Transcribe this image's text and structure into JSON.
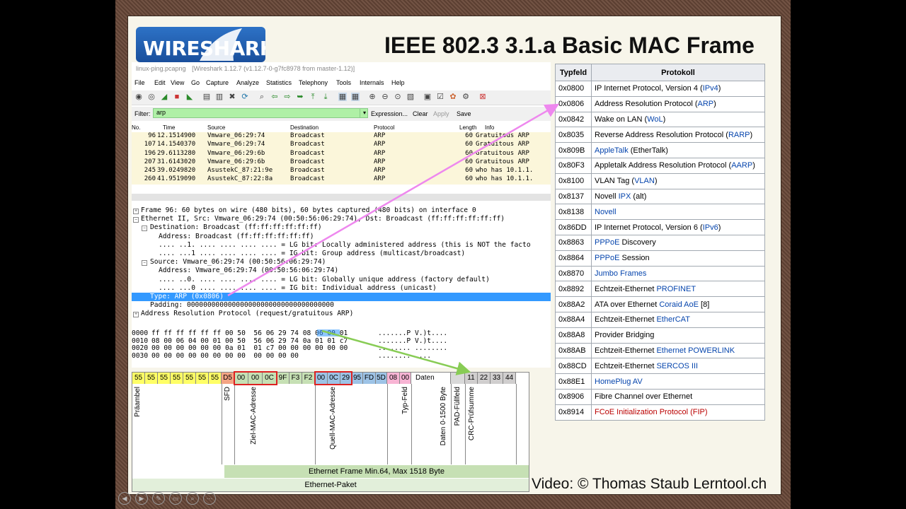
{
  "slide": {
    "logo_text": "WIRESHARK",
    "title": "IEEE 802.3 3.1.a Basic MAC Frame",
    "credit": "Video: © Thomas Staub Lerntool.ch"
  },
  "wireshark": {
    "window_file": "linux-ping.pcapng",
    "window_app": "[Wireshark 1.12.7 (v1.12.7-0-g7fc8978 from master-1.12)]",
    "menu": [
      "File",
      "Edit",
      "View",
      "Go",
      "Capture",
      "Analyze",
      "Statistics",
      "Telephony",
      "Tools",
      "Internals",
      "Help"
    ],
    "filter": {
      "label": "Filter:",
      "value": "arp",
      "expression": "Expression...",
      "clear": "Clear",
      "apply": "Apply",
      "save": "Save"
    },
    "columns": [
      "No.",
      "Time",
      "Source",
      "Destination",
      "Protocol",
      "Length",
      "Info"
    ],
    "packets": [
      {
        "no": "96",
        "time": "12.1514900",
        "src": "Vmware_06:29:74",
        "dst": "Broadcast",
        "proto": "ARP",
        "len": "60",
        "info": "Gratuitous ARP"
      },
      {
        "no": "107",
        "time": "14.1540370",
        "src": "Vmware_06:29:74",
        "dst": "Broadcast",
        "proto": "ARP",
        "len": "60",
        "info": "Gratuitous ARP"
      },
      {
        "no": "196",
        "time": "29.6113280",
        "src": "Vmware_06:29:6b",
        "dst": "Broadcast",
        "proto": "ARP",
        "len": "60",
        "info": "Gratuitous ARP"
      },
      {
        "no": "207",
        "time": "31.6143020",
        "src": "Vmware_06:29:6b",
        "dst": "Broadcast",
        "proto": "ARP",
        "len": "60",
        "info": "Gratuitous ARP"
      },
      {
        "no": "245",
        "time": "39.0249820",
        "src": "AsustekC_87:21:9e",
        "dst": "Broadcast",
        "proto": "ARP",
        "len": "60",
        "info": "who has 10.1.1."
      },
      {
        "no": "260",
        "time": "41.9519090",
        "src": "AsustekC_87:22:8a",
        "dst": "Broadcast",
        "proto": "ARP",
        "len": "60",
        "info": "who has 10.1.1."
      }
    ],
    "details": [
      "Frame 96: 60 bytes on wire (480 bits), 60 bytes captured (480 bits) on interface 0",
      "Ethernet II, Src: Vmware_06:29:74 (00:50:56:06:29:74), Dst: Broadcast (ff:ff:ff:ff:ff:ff)",
      "Destination: Broadcast (ff:ff:ff:ff:ff:ff)",
      "Address: Broadcast (ff:ff:ff:ff:ff:ff)",
      ".... ..1. .... .... .... .... = LG bit: Locally administered address (this is NOT the facto",
      ".... ...1 .... .... .... .... = IG bit: Group address (multicast/broadcast)",
      "Source: Vmware_06:29:74 (00:50:56:06:29:74)",
      "Address: Vmware_06:29:74 (00:50:56:06:29:74)",
      ".... ..0. .... .... .... .... = LG bit: Globally unique address (factory default)",
      ".... ...0 .... .... .... .... = IG bit: Individual address (unicast)",
      "Type: ARP (0x0806)",
      "Padding: 000000000000000000000000000000000000",
      "Address Resolution Protocol (request/gratuitous ARP)"
    ],
    "hex": [
      {
        "off": "0000",
        "bytes": "ff ff ff ff ff ff 00 50  56 06 29 74 08 06 00 01",
        "ascii": ".......P V.)t...."
      },
      {
        "off": "0010",
        "bytes": "08 00 06 04 00 01 00 50  56 06 29 74 0a 01 01 c7",
        "ascii": ".......P V.)t...."
      },
      {
        "off": "0020",
        "bytes": "00 00 00 00 00 00 0a 01  01 c7 00 00 00 00 00 00",
        "ascii": "........ ........"
      },
      {
        "off": "0030",
        "bytes": "00 00 00 00 00 00 00 00  00 00 00 00",
        "ascii": "........ ...."
      }
    ]
  },
  "frame_diagram": {
    "cells": [
      "55",
      "55",
      "55",
      "55",
      "55",
      "55",
      "55",
      "D5",
      "00",
      "00",
      "0C",
      "9F",
      "F3",
      "F2",
      "00",
      "0C",
      "29",
      "95",
      "FD",
      "5D",
      "08",
      "00",
      "Daten",
      "",
      "11",
      "22",
      "33",
      "44"
    ],
    "labels": {
      "preamble": "Präambel",
      "sfd": "SFD",
      "dest": "Ziel-MAC-Adresse",
      "src": "Quell-MAC-Adresse",
      "type": "Typ-Feld",
      "data": "Daten 0-1500 Byte",
      "pad": "PAD-Füllfeld",
      "crc": "CRC-Prüfsumme"
    },
    "frame_band": "Ethernet Frame Min.64, Max 1518 Byte",
    "packet_band": "Ethernet-Paket"
  },
  "typfeld_table": {
    "headers": [
      "Typfeld",
      "Protokoll"
    ],
    "rows": [
      {
        "code": "0x0800",
        "pre": "IP Internet Protocol, Version 4 (",
        "link": "IPv4",
        "post": ")"
      },
      {
        "code": "0x0806",
        "pre": "Address Resolution Protocol (",
        "link": "ARP",
        "post": ")"
      },
      {
        "code": "0x0842",
        "pre": "Wake on LAN (",
        "link": "WoL",
        "post": ")"
      },
      {
        "code": "0x8035",
        "pre": "Reverse Address Resolution Protocol (",
        "link": "RARP",
        "post": ")"
      },
      {
        "code": "0x809B",
        "pre": "",
        "link": "AppleTalk",
        "post": " (EtherTalk)"
      },
      {
        "code": "0x80F3",
        "pre": "Appletalk Address Resolution Protocol (",
        "link": "AARP",
        "post": ")"
      },
      {
        "code": "0x8100",
        "pre": "VLAN Tag (",
        "link": "VLAN",
        "post": ")"
      },
      {
        "code": "0x8137",
        "pre": "Novell ",
        "link": "IPX",
        "post": " (alt)"
      },
      {
        "code": "0x8138",
        "pre": "",
        "link": "Novell",
        "post": ""
      },
      {
        "code": "0x86DD",
        "pre": "IP Internet Protocol, Version 6 (",
        "link": "IPv6",
        "post": ")"
      },
      {
        "code": "0x8863",
        "pre": "",
        "link": "PPPoE",
        "post": " Discovery"
      },
      {
        "code": "0x8864",
        "pre": "",
        "link": "PPPoE",
        "post": " Session"
      },
      {
        "code": "0x8870",
        "pre": "",
        "link": "Jumbo Frames",
        "post": ""
      },
      {
        "code": "0x8892",
        "pre": "Echtzeit-Ethernet ",
        "link": "PROFINET",
        "post": ""
      },
      {
        "code": "0x88A2",
        "pre": "ATA over Ethernet ",
        "link": "Coraid AoE",
        "post": " [8]"
      },
      {
        "code": "0x88A4",
        "pre": "Echtzeit-Ethernet ",
        "link": "EtherCAT",
        "post": ""
      },
      {
        "code": "0x88A8",
        "pre": "Provider Bridging",
        "link": "",
        "post": ""
      },
      {
        "code": "0x88AB",
        "pre": "Echtzeit-Ethernet ",
        "link": "Ethernet POWERLINK",
        "post": ""
      },
      {
        "code": "0x88CD",
        "pre": "Echtzeit-Ethernet ",
        "link": "SERCOS III",
        "post": ""
      },
      {
        "code": "0x88E1",
        "pre": "",
        "link": "HomePlug AV",
        "post": ""
      },
      {
        "code": "0x8906",
        "pre": "Fibre Channel over Ethernet",
        "link": "",
        "post": ""
      },
      {
        "code": "0x8914",
        "pre": "",
        "link": "FCoE Initialization Protocol (FIP)",
        "post": ""
      }
    ]
  }
}
